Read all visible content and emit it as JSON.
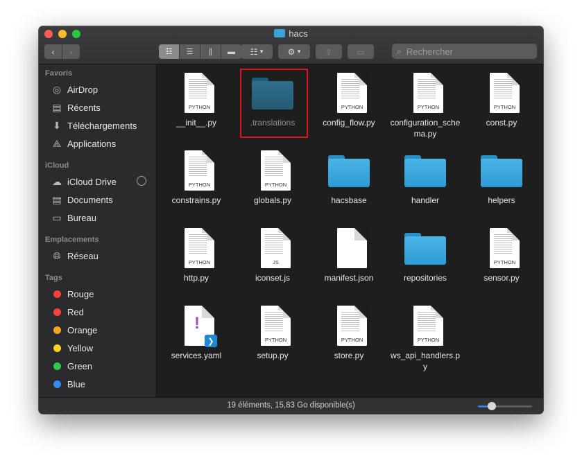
{
  "window": {
    "title": "hacs"
  },
  "toolbar": {
    "back_icon": "chevron-left-icon",
    "forward_icon": "chevron-right-icon",
    "view_modes": [
      "icon-view",
      "list-view",
      "column-view",
      "gallery-view"
    ],
    "search_placeholder": "Rechercher"
  },
  "sidebar": {
    "sections": [
      {
        "title": "Favoris",
        "items": [
          {
            "label": "AirDrop",
            "icon": "airdrop-icon"
          },
          {
            "label": "Récents",
            "icon": "recents-icon"
          },
          {
            "label": "Téléchargements",
            "icon": "downloads-icon"
          },
          {
            "label": "Applications",
            "icon": "applications-icon"
          }
        ]
      },
      {
        "title": "iCloud",
        "items": [
          {
            "label": "iCloud Drive",
            "icon": "cloud-icon"
          },
          {
            "label": "Documents",
            "icon": "document-icon"
          },
          {
            "label": "Bureau",
            "icon": "desktop-icon"
          }
        ]
      },
      {
        "title": "Emplacements",
        "items": [
          {
            "label": "Réseau",
            "icon": "network-icon"
          }
        ]
      },
      {
        "title": "Tags",
        "items": [
          {
            "label": "Rouge",
            "color": "#f4413c"
          },
          {
            "label": "Red",
            "color": "#f4413c"
          },
          {
            "label": "Orange",
            "color": "#f5a623"
          },
          {
            "label": "Yellow",
            "color": "#f8d21d"
          },
          {
            "label": "Green",
            "color": "#2dc84d"
          },
          {
            "label": "Blue",
            "color": "#2f8bf0"
          }
        ]
      }
    ]
  },
  "files": [
    {
      "name": "__init__.py",
      "kind": "python",
      "badge": "PYTHON"
    },
    {
      "name": ".translations",
      "kind": "folder-hidden"
    },
    {
      "name": "config_flow.py",
      "kind": "python",
      "badge": "PYTHON"
    },
    {
      "name": "configuration_schema.py",
      "kind": "python",
      "badge": "PYTHON"
    },
    {
      "name": "const.py",
      "kind": "python",
      "badge": "PYTHON"
    },
    {
      "name": "constrains.py",
      "kind": "python",
      "badge": "PYTHON"
    },
    {
      "name": "globals.py",
      "kind": "python",
      "badge": "PYTHON"
    },
    {
      "name": "hacsbase",
      "kind": "folder"
    },
    {
      "name": "handler",
      "kind": "folder"
    },
    {
      "name": "helpers",
      "kind": "folder"
    },
    {
      "name": "http.py",
      "kind": "python",
      "badge": "PYTHON"
    },
    {
      "name": "iconset.js",
      "kind": "js",
      "badge": "JS"
    },
    {
      "name": "manifest.json",
      "kind": "json"
    },
    {
      "name": "repositories",
      "kind": "folder"
    },
    {
      "name": "sensor.py",
      "kind": "python",
      "badge": "PYTHON"
    },
    {
      "name": "services.yaml",
      "kind": "yaml",
      "badge": "!"
    },
    {
      "name": "setup.py",
      "kind": "python",
      "badge": "PYTHON"
    },
    {
      "name": "store.py",
      "kind": "python",
      "badge": "PYTHON"
    },
    {
      "name": "ws_api_handlers.py",
      "kind": "python",
      "badge": "PYTHON"
    }
  ],
  "highlighted_file": ".translations",
  "highlight_color": "#e1141a",
  "status": {
    "text": "19 éléments, 15,83 Go disponible(s)",
    "zoom_level": 0.25
  }
}
